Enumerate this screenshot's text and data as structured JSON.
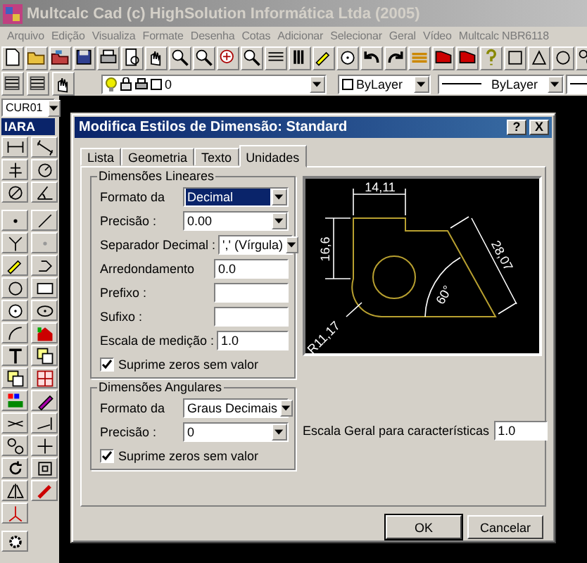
{
  "window": {
    "title": "Multcalc Cad (c) HighSolution Informática Ltda (2005)"
  },
  "menu": [
    "Arquivo",
    "Edição",
    "Visualiza",
    "Formate",
    "Desenha",
    "Cotas",
    "Adicionar",
    "Selecionar",
    "Geral",
    "Vídeo",
    "Multcalc NBR6118"
  ],
  "layer_toolbar": {
    "layer": "0",
    "color_setting": "ByLayer",
    "linetype": "ByLayer"
  },
  "side_palette": {
    "style": "CUR01",
    "label": "IARA"
  },
  "dialog": {
    "title": "Modifica Estilos de Dimensão: Standard",
    "title_buttons": [
      "?",
      "X"
    ],
    "tabs": [
      {
        "label": "Lista",
        "selected": false
      },
      {
        "label": "Geometria",
        "selected": false
      },
      {
        "label": "Texto",
        "selected": false
      },
      {
        "label": "Unidades",
        "selected": true
      }
    ],
    "linear": {
      "title": "Dimensões Lineares",
      "fields": [
        {
          "kind": "select",
          "label": "Formato da",
          "value": "Decimal",
          "highlighted": true
        },
        {
          "kind": "select",
          "label": "Precisão :",
          "value": "0.00",
          "highlighted": false
        },
        {
          "kind": "select",
          "label": "Separador Decimal :",
          "value": "',' (Vírgula)",
          "highlighted": false
        },
        {
          "kind": "input",
          "label": "Arredondamento",
          "value": "0.0",
          "highlighted": false
        },
        {
          "kind": "input",
          "label": "Prefixo :",
          "highlighted": false
        },
        {
          "kind": "input",
          "label": "Sufixo :",
          "highlighted": false
        },
        {
          "kind": "input",
          "label": "Escala de medição :",
          "value": "1.0",
          "highlighted": false
        }
      ],
      "checkbox": {
        "label": "Suprime zeros sem valor",
        "checked": true
      }
    },
    "angular": {
      "title": "Dimensões Angulares",
      "fields": [
        {
          "kind": "select",
          "label": "Formato da",
          "value": "Graus Decimais",
          "highlighted": false
        },
        {
          "kind": "select",
          "label": "Precisão :",
          "value": "0",
          "highlighted": false
        }
      ],
      "checkbox": {
        "label": "Suprime zeros sem valor",
        "checked": true
      }
    },
    "preview": {
      "labels": [
        "14,11",
        "16,6",
        "28,07",
        "60°",
        "R11,17"
      ]
    },
    "scale": {
      "label": "Escala Geral para características",
      "value": "1.0"
    },
    "buttons": [
      "OK",
      "Cancelar"
    ]
  }
}
